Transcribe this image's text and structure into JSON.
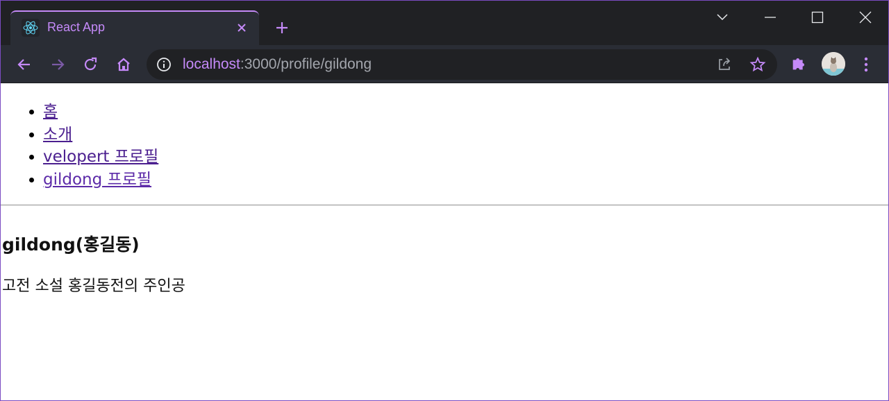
{
  "browser": {
    "tab_title": "React App",
    "url_host": "localhost",
    "url_rest": ":3000/profile/gildong",
    "accent_color": "#c58af9",
    "icons": {
      "favicon": "react-logo-icon",
      "tab_close": "close-icon",
      "new_tab": "plus-icon",
      "tab_search": "chevron-down-icon",
      "minimize": "minimize-icon",
      "maximize": "maximize-icon",
      "window_close": "close-icon",
      "back": "arrow-left-icon",
      "forward": "arrow-right-icon",
      "reload": "reload-icon",
      "home": "home-icon",
      "site_info": "info-icon",
      "share": "share-icon",
      "bookmark": "star-icon",
      "extensions": "puzzle-icon",
      "menu": "kebab-icon"
    }
  },
  "page": {
    "nav": [
      {
        "label": "홈"
      },
      {
        "label": "소개"
      },
      {
        "label": "velopert 프로필"
      },
      {
        "label": "gildong 프로필"
      }
    ],
    "profile": {
      "title": "gildong(홍길동)",
      "description": "고전 소설 홍길동전의 주인공"
    }
  }
}
